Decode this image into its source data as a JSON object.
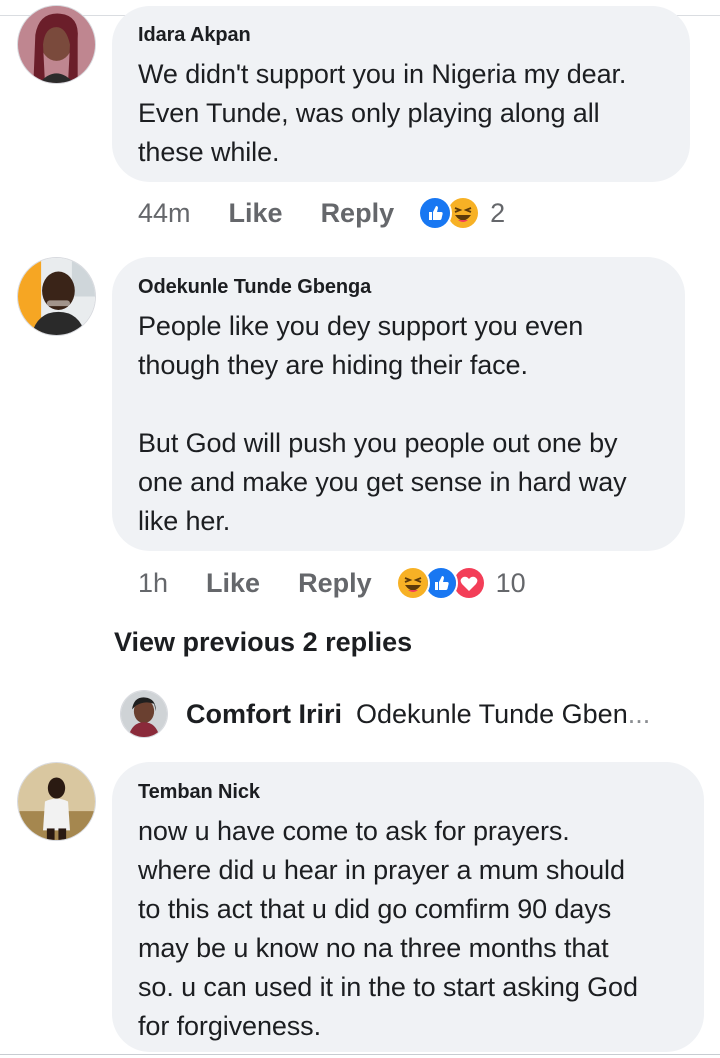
{
  "comments": [
    {
      "author": "Idara Akpan",
      "text": "We didn't support you in Nigeria my dear.\nEven Tunde, was only playing along all\nthese while.",
      "time": "44m",
      "like_label": "Like",
      "reply_label": "Reply",
      "reactions": [
        "like-reaction-icon",
        "haha-reaction-icon"
      ],
      "reaction_count": "2"
    },
    {
      "author": "Odekunle Tunde Gbenga",
      "text": "People like you dey support you even\nthough they are hiding their face.\n\nBut God will push you people out one by\none and make you get sense in hard way\nlike her.",
      "time": "1h",
      "like_label": "Like",
      "reply_label": "Reply",
      "reactions": [
        "haha-reaction-icon",
        "like-reaction-icon",
        "love-reaction-icon"
      ],
      "reaction_count": "10"
    },
    {
      "author": "Temban Nick",
      "text": "now u have come to ask for prayers.\nwhere did u hear in prayer a mum should\nto this act that u did go comfirm 90 days\nmay be u know no na three months that\nso. u can used it in the to start asking God\nfor forgiveness."
    }
  ],
  "replies": {
    "view_previous_label": "View previous 2 replies",
    "collapsed_author": "Comfort Iriri",
    "collapsed_text": "Odekunle Tunde Gben",
    "ellipsis": "..."
  },
  "colors": {
    "bubble_bg": "#f0f2f5",
    "meta_text": "#65676b",
    "like_blue": "#1877f2",
    "love_red": "#f33e58",
    "haha_yellow": "#f7b125"
  }
}
